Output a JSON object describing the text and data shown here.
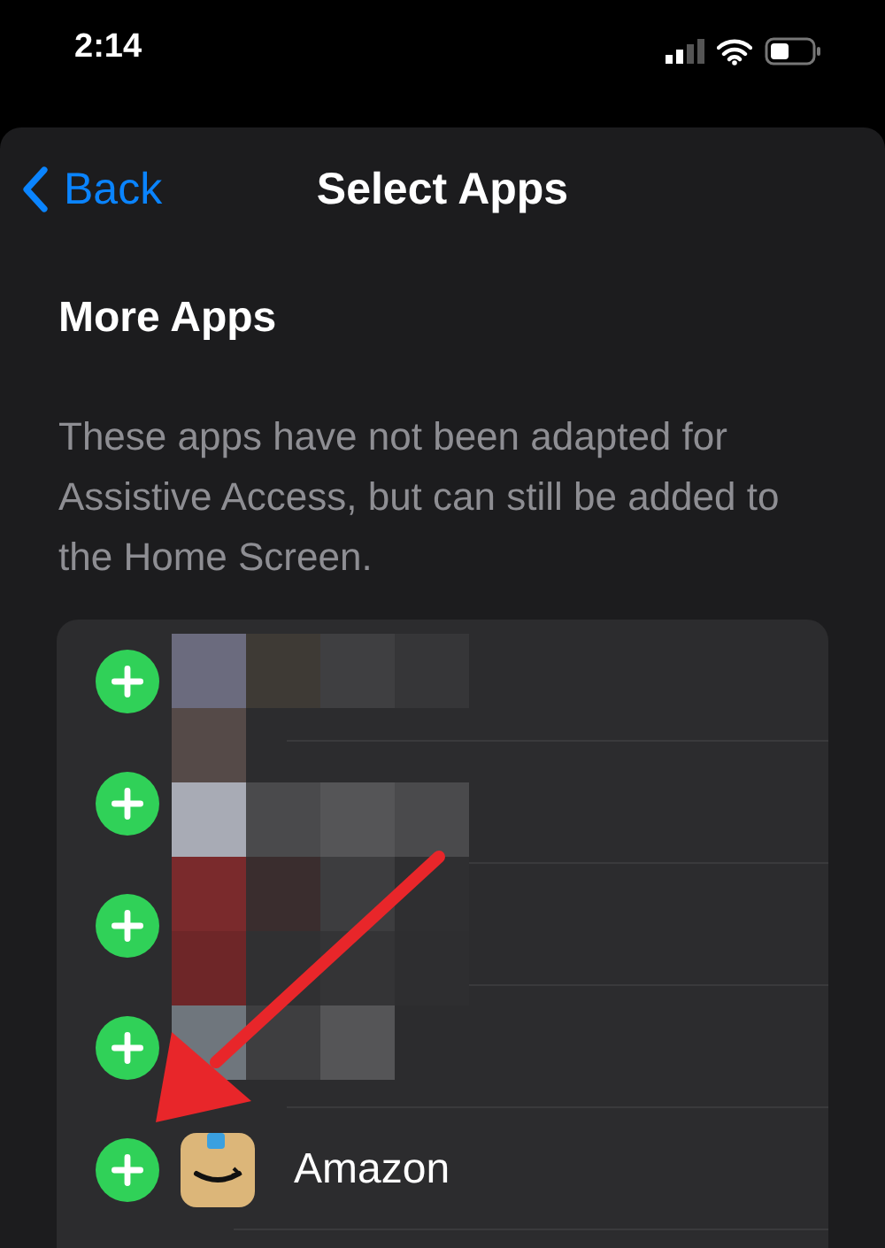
{
  "status_bar": {
    "time": "2:14"
  },
  "nav": {
    "back": "Back",
    "title": "Select Apps"
  },
  "section": {
    "heading": "More Apps",
    "description": "These apps have not been adapted for Assistive Access, but can still be added to the Home Screen."
  },
  "apps": [
    {
      "kind": "hidden"
    },
    {
      "kind": "hidden"
    },
    {
      "kind": "hidden"
    },
    {
      "kind": "hidden"
    },
    {
      "kind": "app",
      "name": "Amazon"
    }
  ]
}
